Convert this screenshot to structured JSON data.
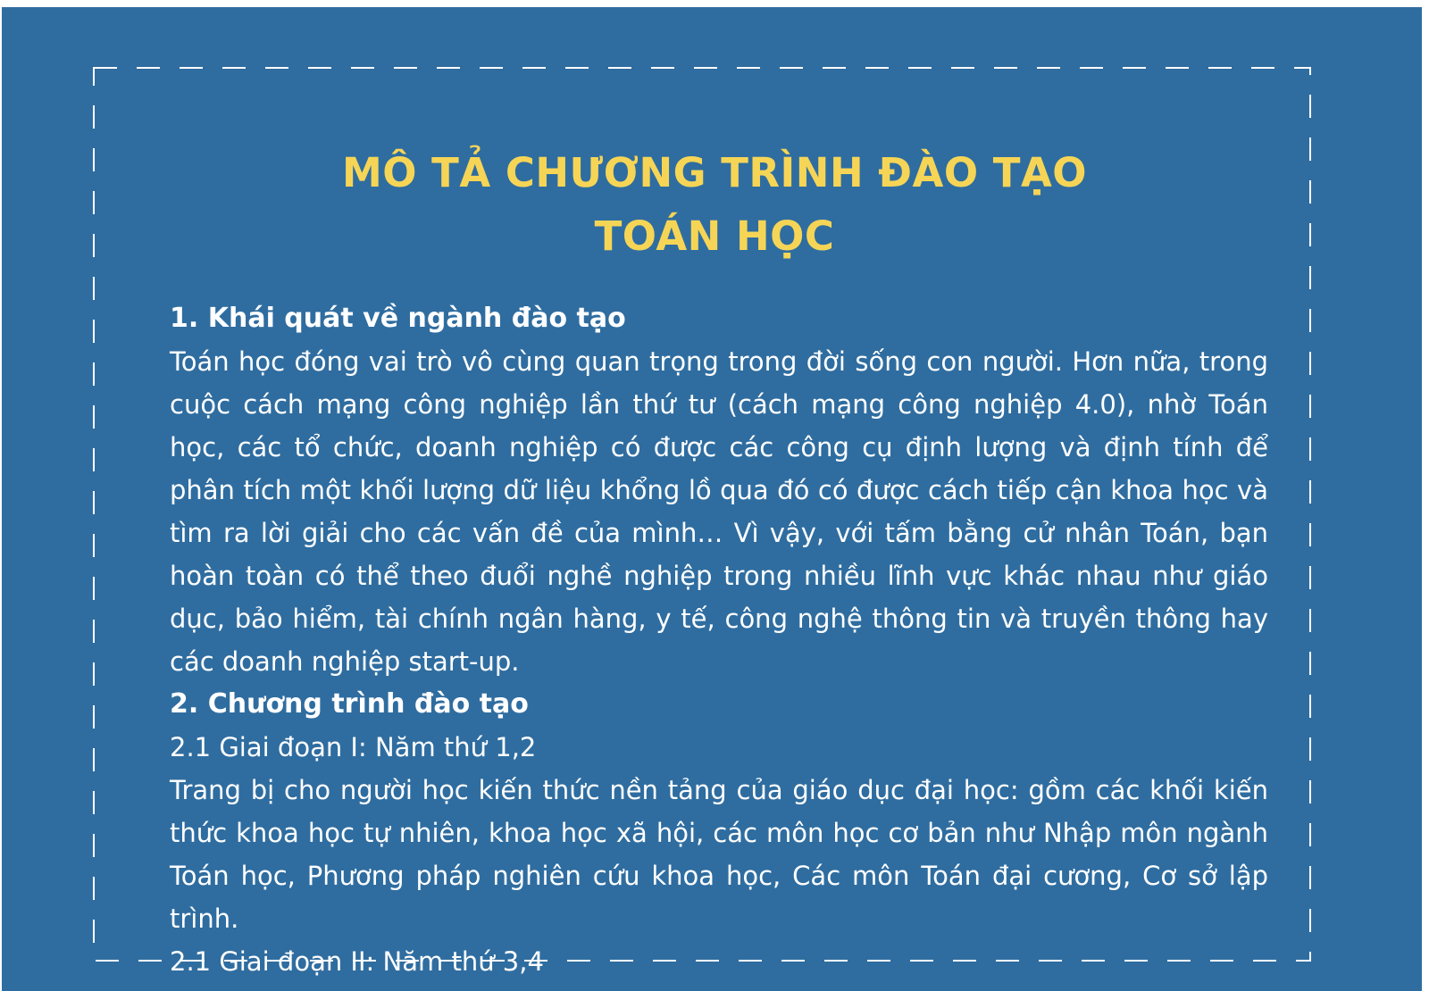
{
  "colors": {
    "background": "#2f6da0",
    "title": "#f6d556",
    "text": "#ffffff",
    "border": "#ffffff"
  },
  "title": {
    "line1": "MÔ TẢ CHƯƠNG TRÌNH ĐÀO TẠO",
    "line2": "TOÁN HỌC"
  },
  "section1": {
    "heading": "1. Khái quát về ngành đào tạo",
    "body": "Toán học đóng vai trò vô cùng quan trọng trong đời sống con người. Hơn nữa, trong cuộc cách mạng công nghiệp lần thứ tư (cách mạng công nghiệp 4.0), nhờ Toán học, các tổ chức, doanh nghiệp có được các công cụ định lượng và định tính để phân tích một khối lượng dữ liệu khổng lồ qua đó có được cách tiếp cận khoa học và tìm ra lời giải cho các vấn đề của mình… Vì vậy, với tấm bằng cử nhân Toán, bạn hoàn toàn có thể theo đuổi nghề nghiệp trong nhiều lĩnh vực khác nhau như giáo dục, bảo hiểm, tài chính ngân hàng, y tế, công nghệ thông tin và truyền thông hay các doanh nghiệp start-up."
  },
  "section2": {
    "heading": "2. Chương trình đào tạo",
    "stage1_label": "2.1 Giai đoạn I: Năm thứ 1,2",
    "stage1_body": "Trang bị cho người học kiến thức nền tảng của giáo dục đại học: gồm các khối kiến thức khoa học tự nhiên, khoa học xã hội, các môn học cơ bản như Nhập môn ngành Toán học, Phương pháp nghiên cứu khoa học, Các môn Toán đại cương, Cơ sở lập trình.",
    "stage2_label": "2.1 Giai đoạn II: Năm thứ 3,4"
  }
}
